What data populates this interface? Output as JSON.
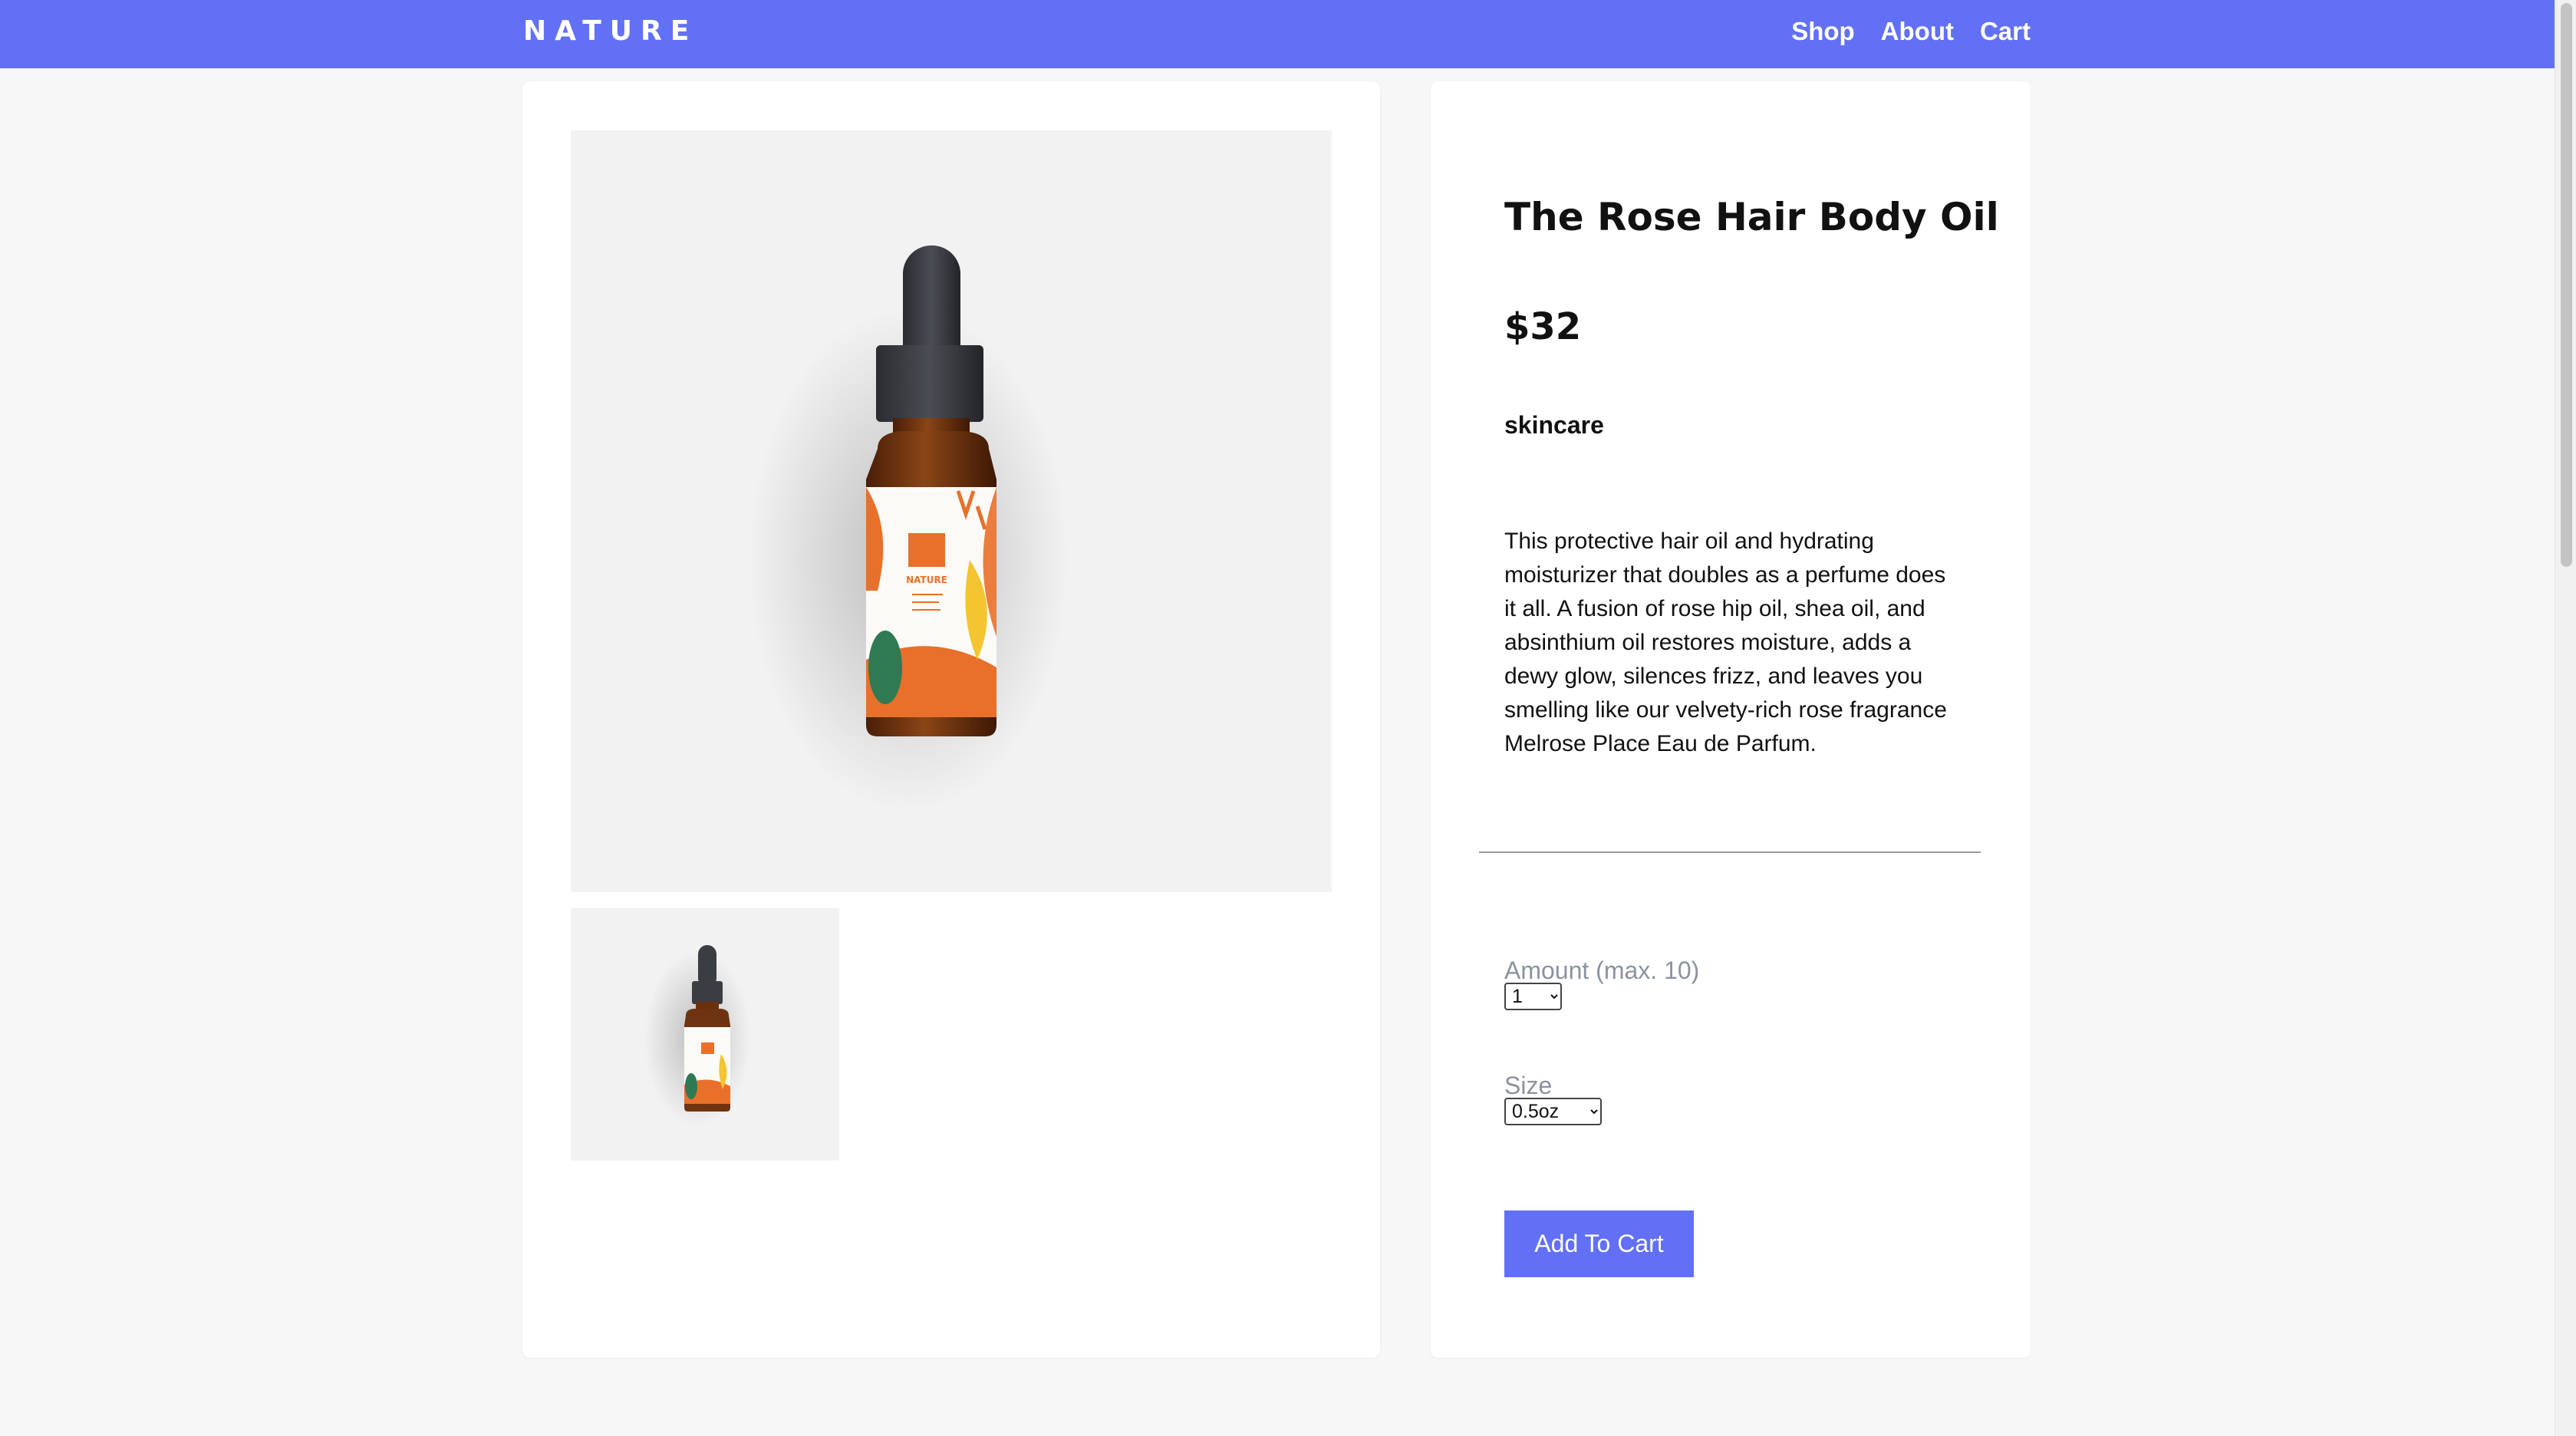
{
  "header": {
    "logo": "NATURE",
    "nav": [
      {
        "label": "Shop"
      },
      {
        "label": "About"
      },
      {
        "label": "Cart"
      }
    ],
    "background": "#6270f5"
  },
  "product": {
    "title": "The Rose Hair Body Oil",
    "price": "$32",
    "category": "skincare",
    "description": "This protective hair oil and hydrating moisturizer that doubles as a perfume does it all. A fusion of rose hip oil, shea oil, and absinthium oil restores moisture, adds a dewy glow, silences frizz, and leaves you smelling like our velvety-rich rose fragrance Melrose Place Eau de Parfum.",
    "label_brand": "NATURE"
  },
  "options": {
    "amount": {
      "label": "Amount (max. 10)",
      "value": "1"
    },
    "size": {
      "label": "Size",
      "value": "0.5oz"
    }
  },
  "cta": {
    "add_to_cart": "Add To Cart"
  },
  "colors": {
    "accent": "#6270f5",
    "bottle_amber": "#7a3a12",
    "bottle_cap": "#3a3d42",
    "label_orange": "#e8702a",
    "leaf_green": "#2f7a52",
    "label_yellow": "#f4c531"
  }
}
